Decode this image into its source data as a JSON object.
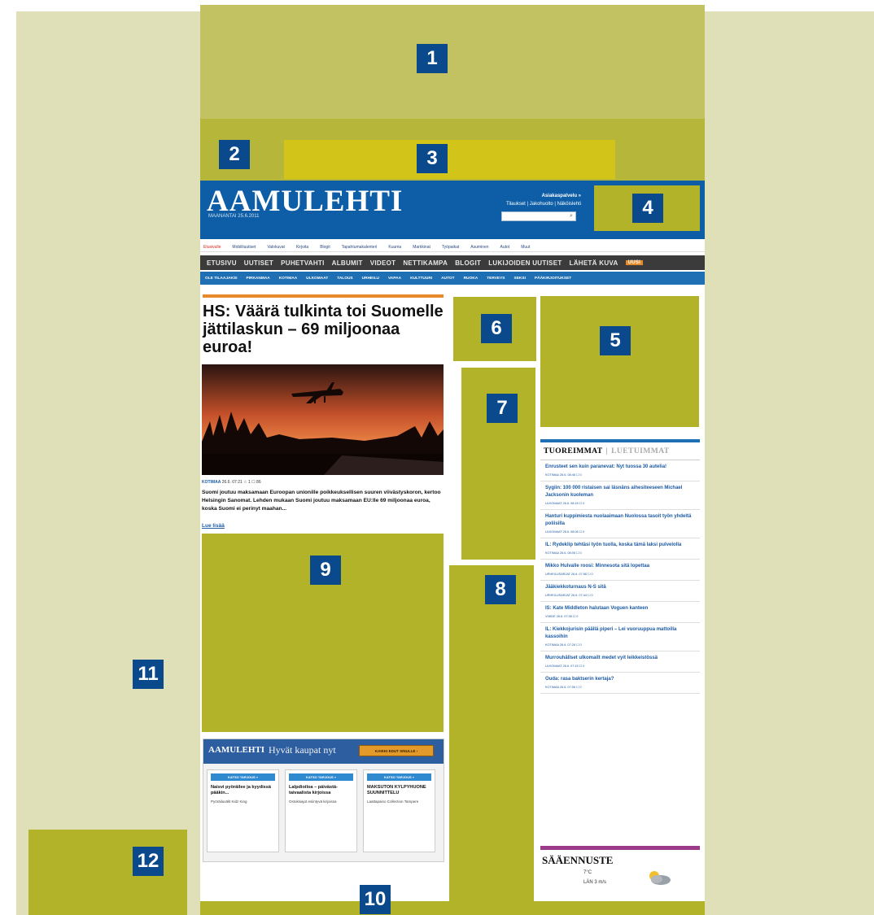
{
  "zones": [
    "1",
    "2",
    "3",
    "4",
    "5",
    "6",
    "7",
    "8",
    "9",
    "10",
    "11",
    "12"
  ],
  "header": {
    "logo": "AAMULEHTI",
    "date": "MAANANTAI 25.6.2011",
    "links_top": "Asiakaspalvelu »",
    "links_bottom": "Tilaukset | Jakohuolto | Näköislehti"
  },
  "nav1": [
    "Etusivulle",
    "Mobiiliuutiset",
    "Valokuvat",
    "Kirjoita",
    "Blogit",
    "Tapahtumakalenteri",
    "Kuuma",
    "Markkinat",
    "Työpaikat",
    "Asuminen",
    "Autot",
    "Muut"
  ],
  "nav2": [
    "ETUSIVU",
    "UUTISET",
    "PUHETVAHTI",
    "ALBUMIT",
    "VIDEOT",
    "NETTIKAMPA",
    "BLOGIT",
    "LUKIJOIDEN UUTISET",
    "LÄHETÄ KUVA"
  ],
  "nav2_new": "UUSI",
  "nav3": [
    "OLE TILAAJAKSI",
    "PIRKANMAA",
    "KOTIMAA",
    "ULKOMAAT",
    "TALOUS",
    "URHEILU",
    "VAPAA",
    "KULTTUURI",
    "AUTOT",
    "RUOKA",
    "TERVEYS",
    "SEKSI",
    "PÄÄKIRJOITUKSET"
  ],
  "article": {
    "headline": "HS: Väärä tulkinta toi Suomelle jättilaskun – 69 miljoonaa euroa!",
    "meta_cat": "KOTIMAA",
    "meta_rest": "26.6. 07:21  ☆ 1  ☐ 86",
    "lead": "Suomi joutuu maksamaan Euroopan unionille poikkeuksellisen suuren viivästyskoron, kertoo Helsingin Sanomat. Lehden mukaan Suomi joutuu maksamaan EU:lle 69 miljoonaa euroa, koska Suomi ei perinyt maahan...",
    "readmore": "Lue lisää"
  },
  "promo": {
    "logo": "AAMULEHTI",
    "title": "Hyvät kaupat nyt",
    "button": "KAIKKI EDUT SINULLE ›",
    "cards": [
      {
        "tag": "KATSO TARJOUS »",
        "title": "Naisvi pyöräilee ja kyydissä pääkin...",
        "sub": "Pyöräiluvälit Kidz King"
      },
      {
        "tag": "KATSO TARJOUS »",
        "title": "Lalpdioiloa – päivästä-taivaalista kirjoissa",
        "sub": "Ostoksiajot esiintyvä kirjoissa"
      },
      {
        "tag": "KATSO TARJOUS »",
        "title": "MAKSUTON KYLPYHUONE SUUNNITTELU",
        "sub": "Laattapaino Collection Tampere"
      }
    ]
  },
  "sidebar": {
    "tab_active": "TUOREIMMAT",
    "tab_inactive": "LUETUIMMAT",
    "items": [
      {
        "title": "Enrusteet sen kuin paranevat: Nyt tuossa 30 autelia!",
        "meta": "KOTIMAA 26.6. 08:46 ☐ 0"
      },
      {
        "title": "Sygiin: 100 000 ristaisen sai läsnäns aihesiteeseen Michael Jacksonin kuoleman",
        "meta": "ULKOMAAT 26.6. 08:18 ☐ 0"
      },
      {
        "title": "Hanturi kuppimiesta nuolaaimaan Nuolossa tasoit työn yhdeltä poliisilla",
        "meta": "ULKOMAAT 26.6. 08:08 ☐ 0"
      },
      {
        "title": "IL: Rydeklip tehtäsi työn tuolla, koska tämä laksi pulvelolla",
        "meta": "KOTIMAA 26.6. 08:05 ☐ 0"
      },
      {
        "title": "Mikko Hulvalle roosi: Minnesota sitä lopettaa",
        "meta": "URHEILUSARJAT 26.6. 07:56 ☐ 0"
      },
      {
        "title": "Jääkiekkoturnaus N-S sitä",
        "meta": "URHEILUSARJAT 26.6. 07:44 ☐ 0"
      },
      {
        "title": "IS: Kate Middleton halutaan Voguen kanteen",
        "meta": "VIIHDE 26.6. 07:38 ☐ 0"
      },
      {
        "title": "IL: Kiekkojurisin päällä piperi – Lei vuoruuppua mattoilla kassoihin",
        "meta": "KOTIMAA 26.6. 07:26 ☐ 0"
      },
      {
        "title": "Murrouhällset ulkomailt medet vyit leikkeistössä",
        "meta": "ULKOMAAT 26.6. 07:15 ☐ 0"
      },
      {
        "title": "Ouda: rasa baktserin kertaja?",
        "meta": "KOTIMAA 26.6. 07:06 ☐ 0"
      }
    ]
  },
  "weather": {
    "title": "SÄÄENNUSTE",
    "temp": "7°C",
    "wind": "LÄN 3 m/s"
  },
  "colors": {
    "zone": "#b3b32a",
    "badge": "#0a4a8c",
    "header": "#0d5ea6"
  }
}
